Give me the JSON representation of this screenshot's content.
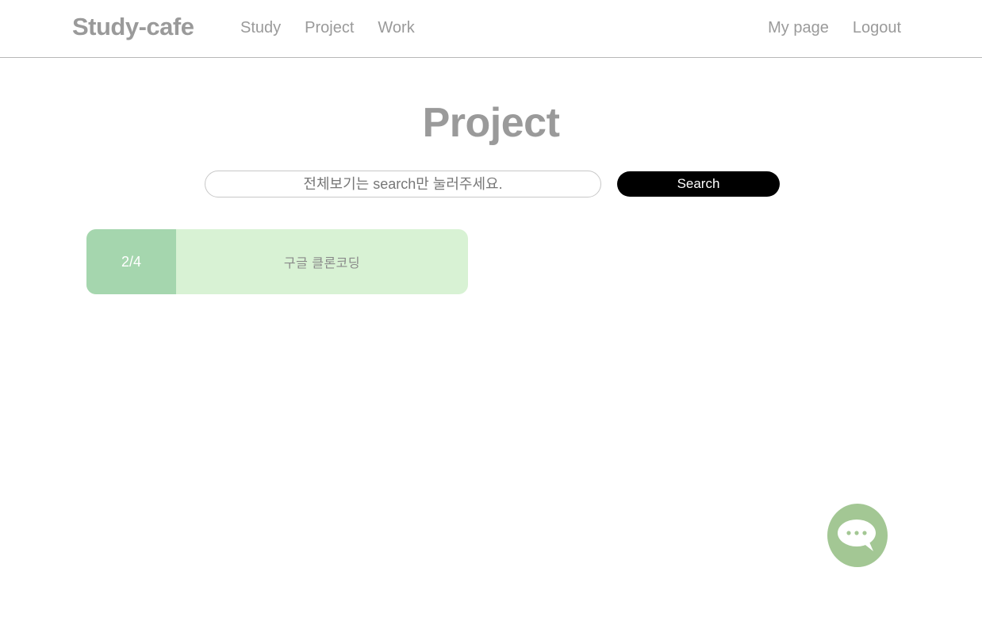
{
  "header": {
    "brand": "Study-cafe",
    "nav_left": [
      {
        "label": "Study"
      },
      {
        "label": "Project"
      },
      {
        "label": "Work"
      }
    ],
    "nav_right": [
      {
        "label": "My page"
      },
      {
        "label": "Logout"
      }
    ]
  },
  "main": {
    "title": "Project",
    "search": {
      "placeholder": "전체보기는 search만 눌러주세요.",
      "value": "",
      "button_label": "Search"
    },
    "projects": [
      {
        "count": "2/4",
        "title": "구글 클론코딩"
      }
    ]
  },
  "chat": {
    "icon": "chat-bubble-icon"
  },
  "colors": {
    "text_gray": "#9a9a9a",
    "card_bg": "#d8f2d4",
    "card_count_bg": "#a5d6ae",
    "chat_bg": "#a3c794",
    "button_bg": "#000000"
  }
}
